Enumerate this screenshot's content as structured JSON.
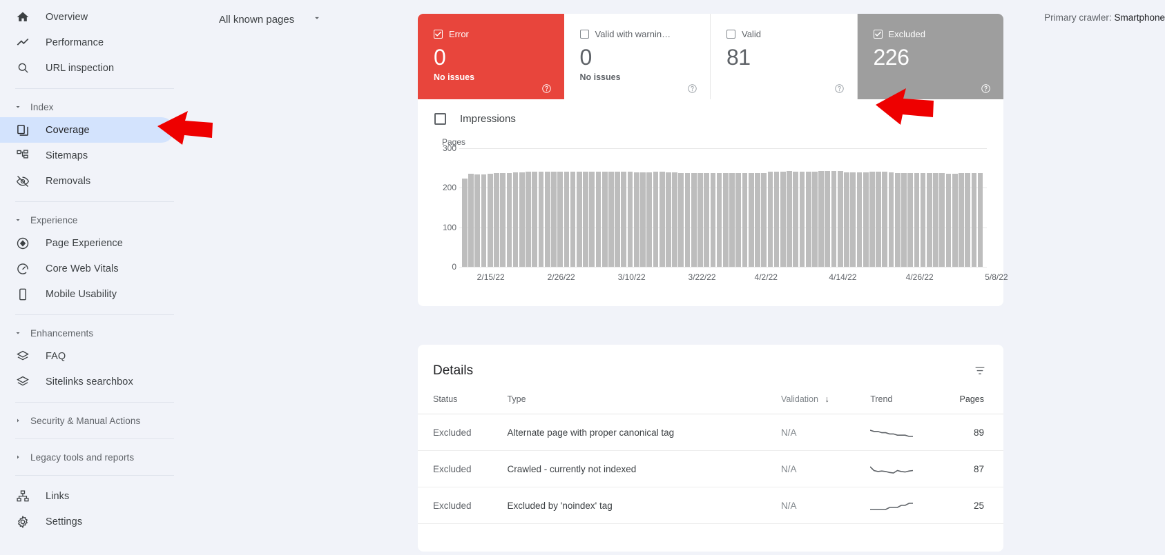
{
  "sidebar": {
    "items": [
      {
        "label": "Overview",
        "icon": "home-icon",
        "type": "item",
        "active": false
      },
      {
        "label": "Performance",
        "icon": "trending-up-icon",
        "type": "item",
        "active": false
      },
      {
        "label": "URL inspection",
        "icon": "search-icon",
        "type": "item",
        "active": false
      },
      {
        "type": "separator"
      },
      {
        "label": "Index",
        "type": "group",
        "expanded": true
      },
      {
        "label": "Coverage",
        "icon": "pages-copy-icon",
        "type": "item",
        "active": true
      },
      {
        "label": "Sitemaps",
        "icon": "sitemap-icon",
        "type": "item",
        "active": false
      },
      {
        "label": "Removals",
        "icon": "eye-off-icon",
        "type": "item",
        "active": false
      },
      {
        "type": "separator"
      },
      {
        "label": "Experience",
        "type": "group",
        "expanded": true
      },
      {
        "label": "Page Experience",
        "icon": "speed-badge-icon",
        "type": "item",
        "active": false
      },
      {
        "label": "Core Web Vitals",
        "icon": "gauge-icon",
        "type": "item",
        "active": false
      },
      {
        "label": "Mobile Usability",
        "icon": "mobile-icon",
        "type": "item",
        "active": false
      },
      {
        "type": "separator"
      },
      {
        "label": "Enhancements",
        "type": "group",
        "expanded": true
      },
      {
        "label": "FAQ",
        "icon": "layers-icon",
        "type": "item",
        "active": false
      },
      {
        "label": "Sitelinks searchbox",
        "icon": "layers-icon",
        "type": "item",
        "active": false
      },
      {
        "type": "separator"
      },
      {
        "label": "Security & Manual Actions",
        "type": "group",
        "expanded": false
      },
      {
        "type": "separator"
      },
      {
        "label": "Legacy tools and reports",
        "type": "group",
        "expanded": false
      },
      {
        "type": "separator"
      },
      {
        "label": "Links",
        "icon": "links-hierarchy-icon",
        "type": "item",
        "active": false
      },
      {
        "label": "Settings",
        "icon": "gear-icon",
        "type": "item",
        "active": false
      }
    ]
  },
  "topbar": {
    "page_selector": "All known pages",
    "page_selector_icon": "chevron-down-icon",
    "crawler_prefix": "Primary crawler:",
    "crawler_value": "Smartphone"
  },
  "cards": [
    {
      "title": "Error",
      "value": "0",
      "sub": "No issues",
      "checked": true,
      "style": "error",
      "help_icon": "help-circle-icon"
    },
    {
      "title": "Valid with warnin…",
      "value": "0",
      "sub": "No issues",
      "checked": false,
      "style": "plain",
      "help_icon": "help-circle-icon"
    },
    {
      "title": "Valid",
      "value": "81",
      "sub": "",
      "checked": false,
      "style": "plain",
      "help_icon": "help-circle-icon"
    },
    {
      "title": "Excluded",
      "value": "226",
      "sub": "",
      "checked": true,
      "style": "excluded",
      "help_icon": "help-circle-icon"
    }
  ],
  "chart_controls": {
    "impressions_label": "Impressions",
    "impressions_checked": false
  },
  "details": {
    "title": "Details",
    "filter_icon": "filter-list-icon",
    "columns": [
      "Status",
      "Type",
      "Validation",
      "Trend",
      "Pages"
    ],
    "sort_column": "Validation",
    "sort_icon": "arrow-down-icon",
    "rows": [
      {
        "status": "Excluded",
        "type": "Alternate page with proper canonical tag",
        "validation": "N/A",
        "pages": "89",
        "trend": [
          26,
          25,
          25,
          24,
          24,
          23,
          23,
          22,
          22,
          22,
          21,
          21
        ]
      },
      {
        "status": "Excluded",
        "type": "Crawled - currently not indexed",
        "validation": "N/A",
        "pages": "87",
        "trend": [
          32,
          24,
          22,
          23,
          22,
          20,
          19,
          24,
          22,
          21,
          23,
          24
        ]
      },
      {
        "status": "Excluded",
        "type": "Excluded by 'noindex' tag",
        "validation": "N/A",
        "pages": "25",
        "trend": [
          24,
          24,
          24,
          24,
          24,
          25,
          25,
          25,
          26,
          26,
          27,
          27
        ]
      }
    ]
  },
  "chart_data": {
    "type": "bar",
    "title": "",
    "xlabel": "",
    "ylabel": "Pages",
    "ylim": [
      0,
      300
    ],
    "yticks": [
      0,
      100,
      200,
      300
    ],
    "ytick_labels": [
      "0",
      "100",
      "200",
      "300"
    ],
    "grid": true,
    "legend": [
      "Impressions"
    ],
    "xtick_labels": [
      "2/15/22",
      "2/26/22",
      "3/10/22",
      "3/22/22",
      "4/2/22",
      "4/14/22",
      "4/26/22",
      "5/8/22"
    ],
    "xtick_positions": [
      4,
      15,
      26,
      37,
      47,
      59,
      71,
      83
    ],
    "series": [
      {
        "name": "Pages",
        "color": "#bdbdbd",
        "values": [
          224,
          235,
          234,
          234,
          235,
          238,
          238,
          238,
          239,
          239,
          240,
          240,
          240,
          241,
          241,
          240,
          240,
          241,
          241,
          241,
          241,
          240,
          240,
          240,
          240,
          240,
          240,
          239,
          239,
          239,
          240,
          240,
          239,
          239,
          238,
          238,
          238,
          238,
          237,
          237,
          238,
          238,
          238,
          238,
          237,
          237,
          237,
          238,
          241,
          241,
          241,
          242,
          240,
          240,
          240,
          240,
          242,
          242,
          242,
          243,
          239,
          239,
          239,
          239,
          240,
          240,
          240,
          239,
          238,
          238,
          238,
          238,
          238,
          238,
          237,
          237,
          236,
          236,
          237,
          237,
          237,
          238
        ]
      }
    ]
  },
  "annotations": {
    "arrow_color": "#ee0000",
    "arrows": [
      {
        "name": "arrow-pointing-coverage",
        "target": "Coverage"
      },
      {
        "name": "arrow-pointing-excluded-card",
        "target": "Excluded"
      }
    ]
  }
}
